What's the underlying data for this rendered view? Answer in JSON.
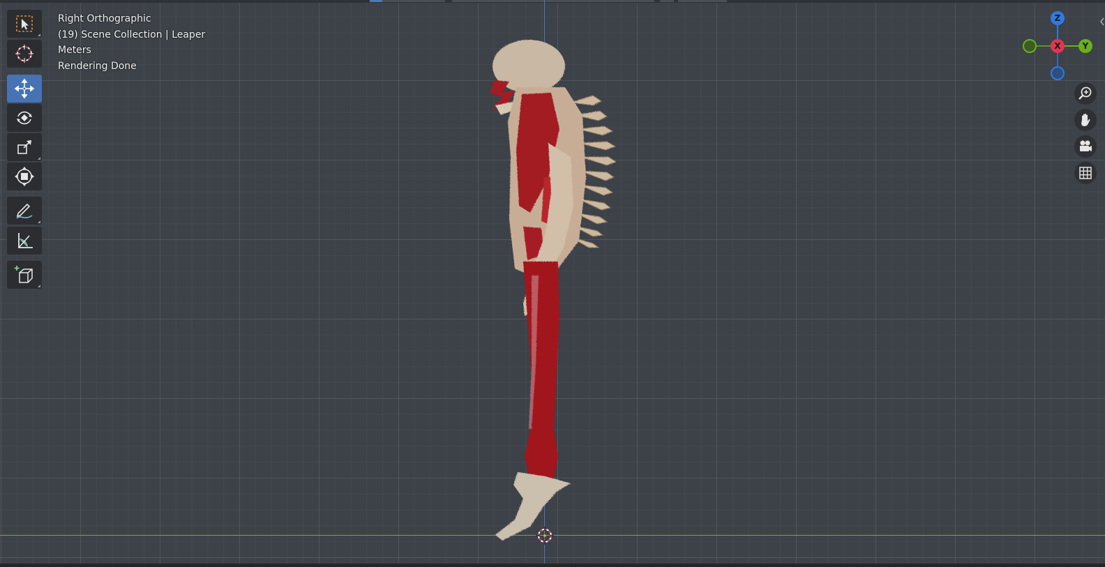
{
  "viewport": {
    "view_name": "Right Orthographic",
    "collection_info": "(19) Scene Collection | Leaper",
    "units": "Meters",
    "status": "Rendering Done",
    "object_name": "Leaper"
  },
  "toolbar": {
    "tools": [
      {
        "name": "select-box-tool",
        "icon": "select-box-icon",
        "active": false
      },
      {
        "name": "cursor-tool",
        "icon": "cursor-icon",
        "active": false
      },
      {
        "name": "move-tool",
        "icon": "move-icon",
        "active": true
      },
      {
        "name": "rotate-tool",
        "icon": "rotate-icon",
        "active": false
      },
      {
        "name": "scale-tool",
        "icon": "scale-icon",
        "active": false
      },
      {
        "name": "transform-tool",
        "icon": "transform-icon",
        "active": false
      },
      {
        "name": "annotate-tool",
        "icon": "annotate-icon",
        "active": false
      },
      {
        "name": "measure-tool",
        "icon": "measure-icon",
        "active": false
      },
      {
        "name": "add-cube-tool",
        "icon": "add-cube-icon",
        "active": false
      }
    ]
  },
  "gizmo": {
    "z_label": "Z",
    "x_label": "X",
    "y_label": "Y",
    "colors": {
      "z": "#2f7be0",
      "x": "#e0364f",
      "y": "#6ab01e"
    }
  },
  "navigation": [
    {
      "name": "zoom-button",
      "icon": "zoom-icon"
    },
    {
      "name": "pan-button",
      "icon": "hand-icon"
    },
    {
      "name": "camera-view-button",
      "icon": "camera-icon"
    },
    {
      "name": "perspective-toggle-button",
      "icon": "grid-icon"
    }
  ],
  "colors": {
    "background": "#3d4148",
    "active_tool": "#4772b3",
    "axis_z": "#4b78b6",
    "axis_y": "#7ea63a"
  }
}
